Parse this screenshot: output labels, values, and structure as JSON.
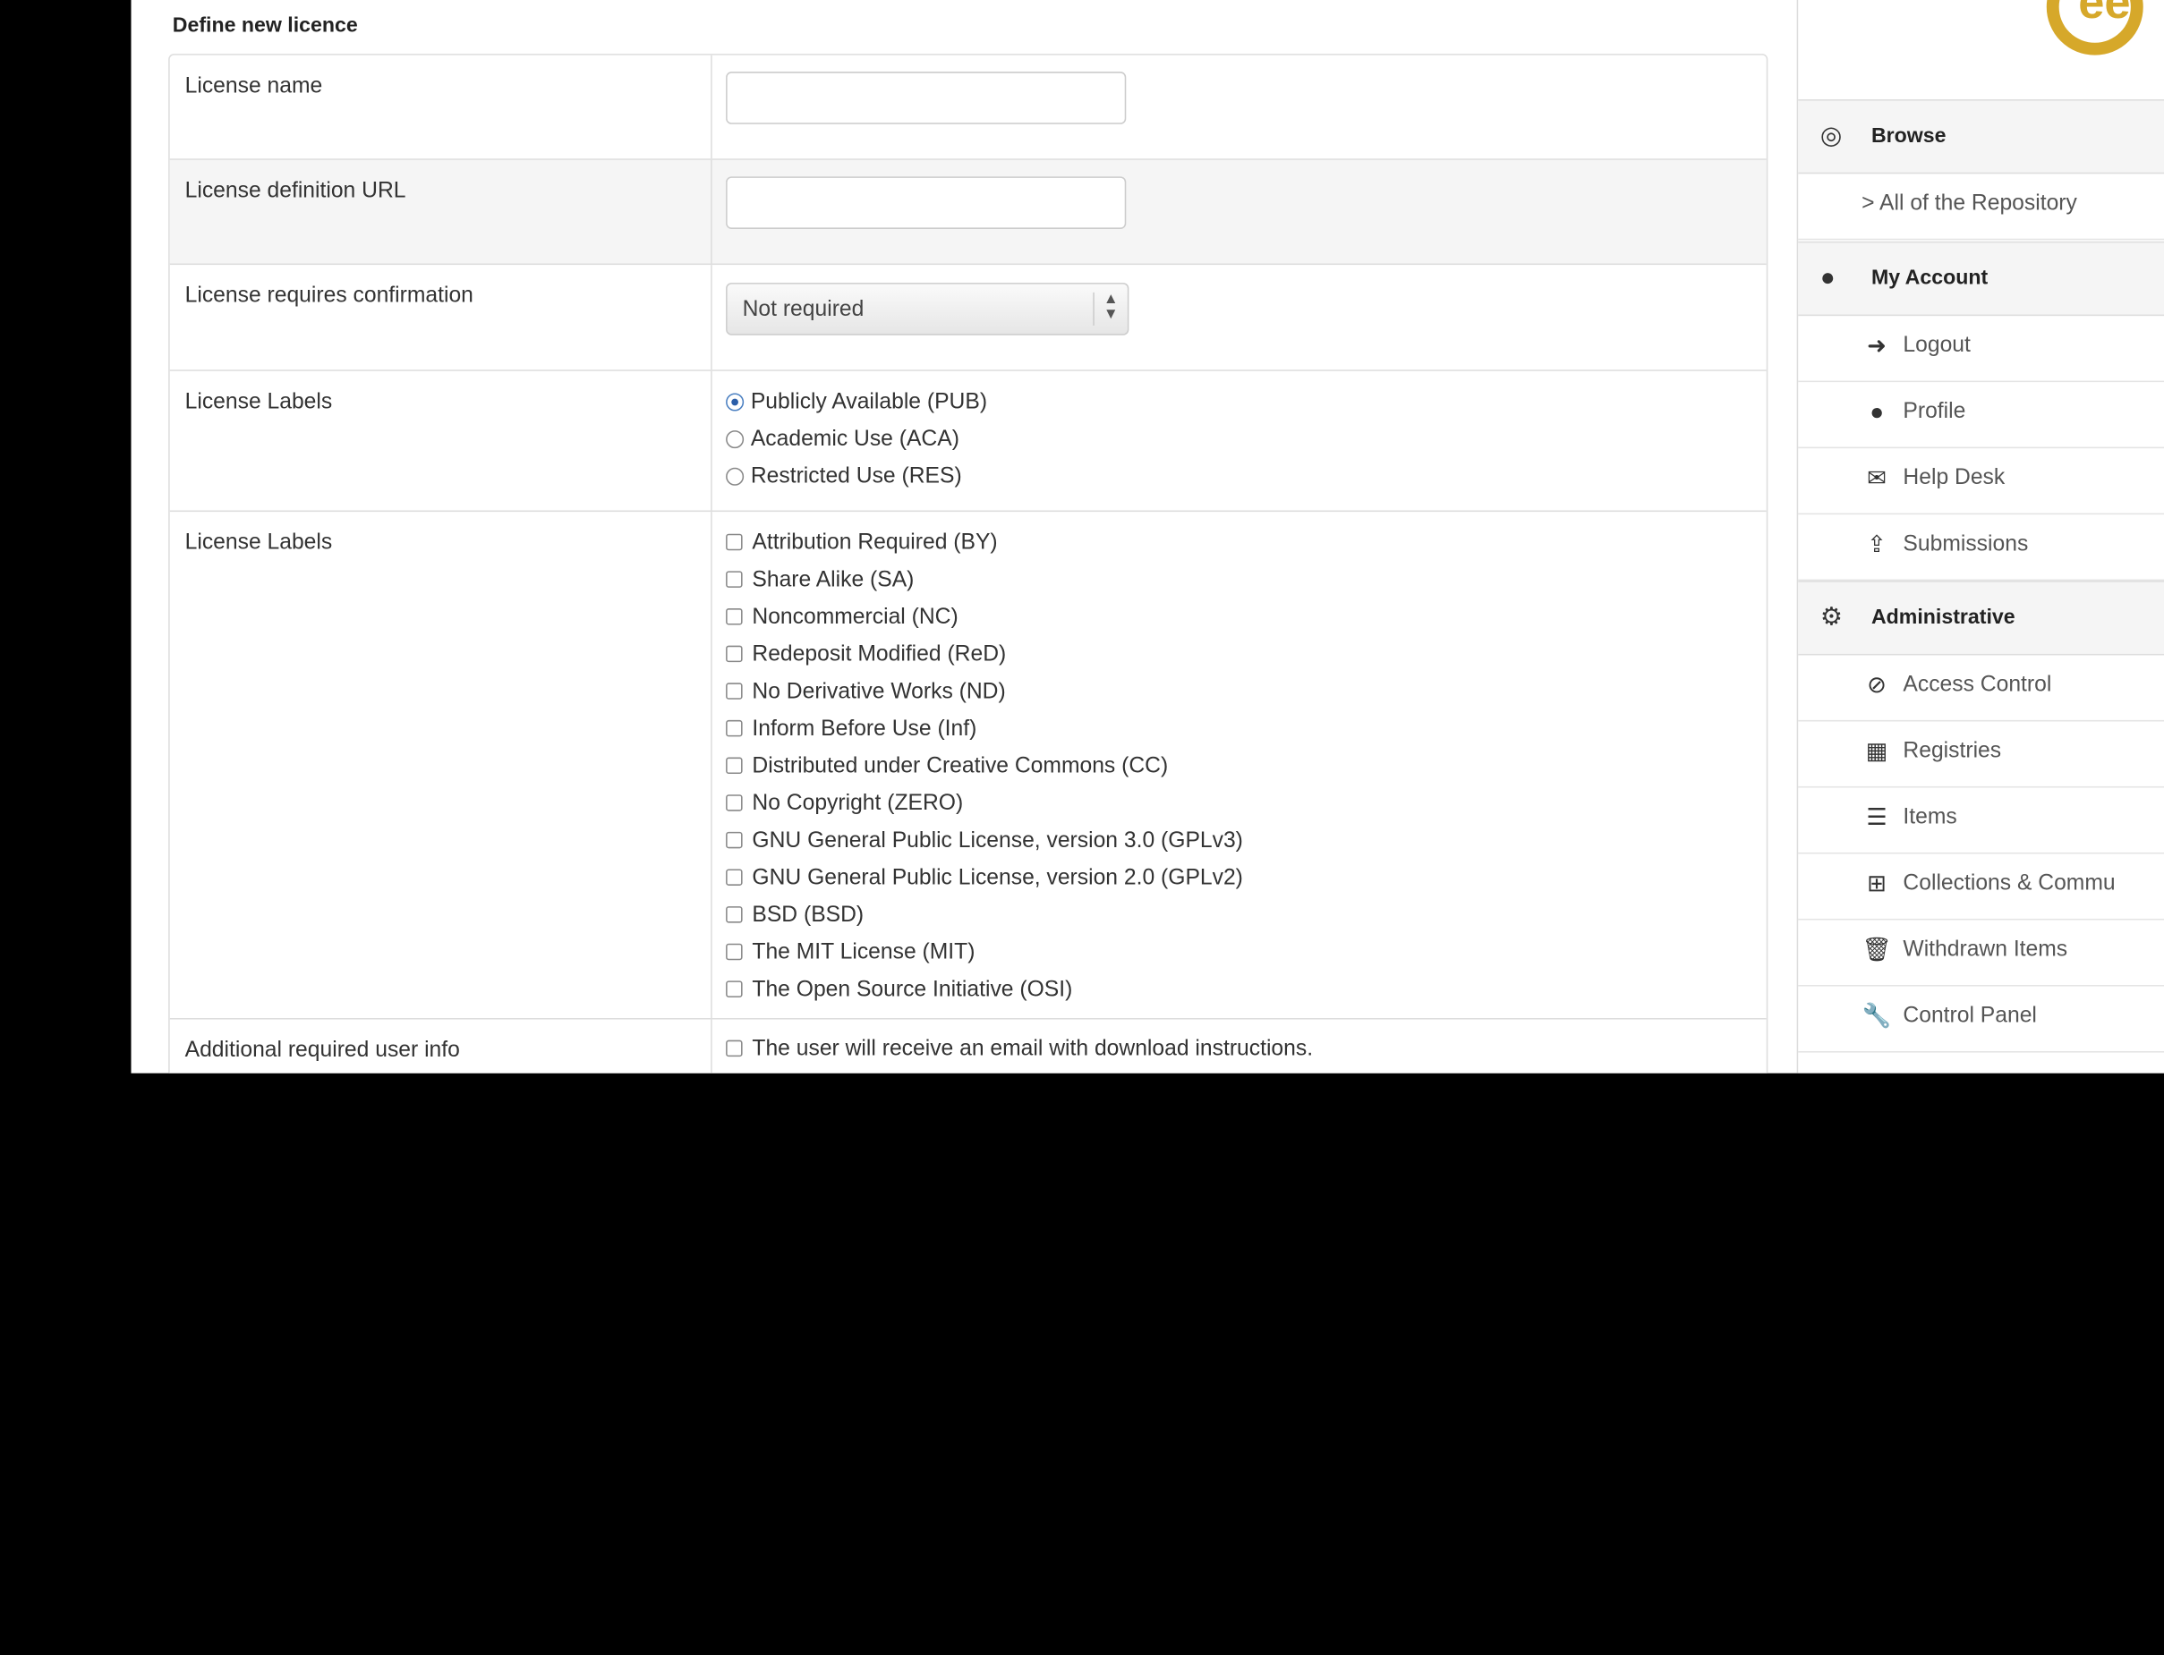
{
  "form": {
    "title": "Define new licence",
    "name_label": "License name",
    "url_label": "License definition URL",
    "confirmation_label": "License requires confirmation",
    "confirmation_value": "Not required",
    "labels_radio_label": "License Labels",
    "radio_options": [
      {
        "label": "Publicly Available (PUB)",
        "selected": true
      },
      {
        "label": "Academic Use (ACA)",
        "selected": false
      },
      {
        "label": "Restricted Use (RES)",
        "selected": false
      }
    ],
    "labels_checkbox_label": "License Labels",
    "checkbox_options": [
      "Attribution Required (BY)",
      "Share Alike (SA)",
      "Noncommercial (NC)",
      "Redeposit Modified (ReD)",
      "No Derivative Works (ND)",
      "Inform Before Use (Inf)",
      "Distributed under Creative Commons (CC)",
      "No Copyright (ZERO)",
      "GNU General Public License, version 3.0 (GPLv3)",
      "GNU General Public License, version 2.0 (GPLv2)",
      "BSD (BSD)",
      "The MIT License (MIT)",
      "The Open Source Initiative (OSI)"
    ],
    "additional_label": "Additional required user info",
    "additional_option": "The user will receive an email with download instructions."
  },
  "sidebar": {
    "browse": {
      "title": "Browse",
      "icon": "target-icon"
    },
    "all_repository": "> All of the Repository",
    "account": {
      "title": "My Account",
      "icon": "user-icon"
    },
    "account_items": [
      {
        "label": "Logout",
        "icon": "logout-icon"
      },
      {
        "label": "Profile",
        "icon": "user-icon"
      },
      {
        "label": "Help Desk",
        "icon": "envelope-icon"
      },
      {
        "label": "Submissions",
        "icon": "upload-icon"
      }
    ],
    "admin": {
      "title": "Administrative",
      "icon": "gears-icon"
    },
    "admin_items": [
      {
        "label": "Access Control",
        "icon": "eye-slash-icon"
      },
      {
        "label": "Registries",
        "icon": "grid-icon"
      },
      {
        "label": "Items",
        "icon": "list-icon"
      },
      {
        "label": "Collections & Commu",
        "icon": "sitemap-icon"
      },
      {
        "label": "Withdrawn Items",
        "icon": "trash-icon"
      },
      {
        "label": "Control Panel",
        "icon": "wrench-icon"
      }
    ]
  }
}
